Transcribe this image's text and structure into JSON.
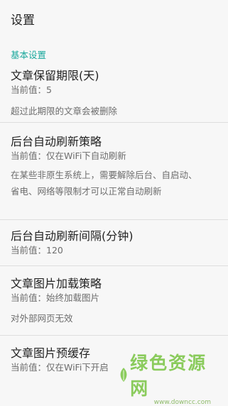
{
  "appbar": {
    "title": "设置"
  },
  "section": {
    "title": "基本设置"
  },
  "prefs": [
    {
      "title": "文章保留期限(天)",
      "summary": "当前值：5",
      "desc": "超过此期限的文章会被删除"
    },
    {
      "title": "后台自动刷新策略",
      "summary": "当前值：仅在WiFi下自动刷新",
      "desc_line1": "在某些非原生系统上，需要解除后台、自启动、",
      "desc_line2": "省电、网络等限制才可以正常自动刷新"
    },
    {
      "title": "后台自动刷新间隔(分钟)",
      "summary": "当前值：120"
    },
    {
      "title": "文章图片加载策略",
      "summary": "当前值：始终加载图片",
      "desc": "对外部网页无效"
    },
    {
      "title": "文章图片预缓存",
      "summary": "当前值：仅在WiFi下开启"
    }
  ],
  "watermark": {
    "text": "绿色资源网",
    "url": "www.downcc.com",
    "color": "#78c442"
  }
}
